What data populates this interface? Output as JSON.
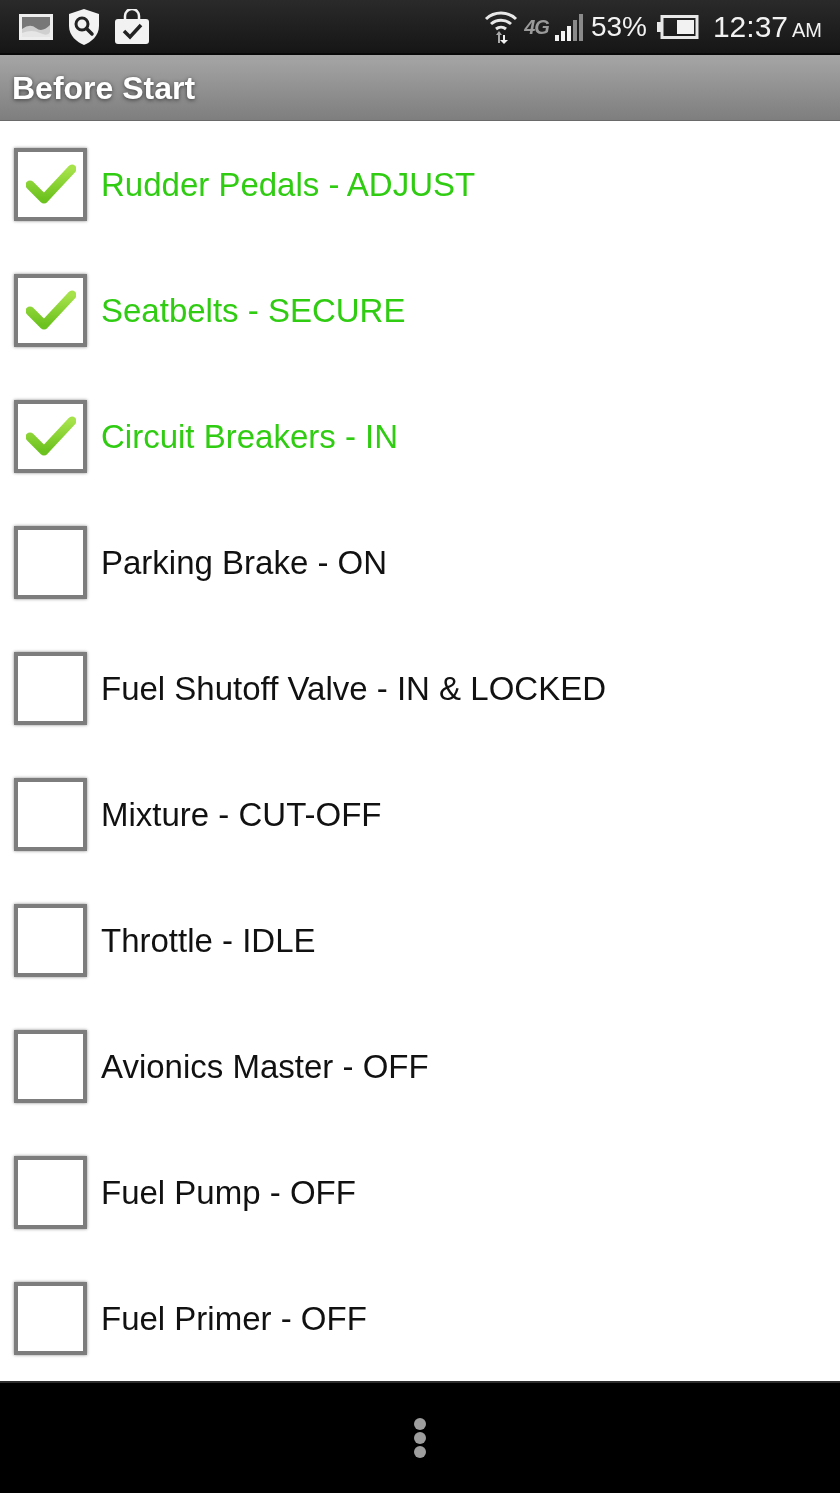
{
  "status_bar": {
    "network": "4G",
    "battery_percent": "53%",
    "time": "12:37",
    "meridiem": "AM"
  },
  "title_bar": {
    "title": "Before Start"
  },
  "checklist": [
    {
      "label": "Rudder Pedals - ADJUST",
      "checked": true
    },
    {
      "label": "Seatbelts - SECURE",
      "checked": true
    },
    {
      "label": "Circuit Breakers - IN",
      "checked": true
    },
    {
      "label": "Parking Brake - ON",
      "checked": false
    },
    {
      "label": "Fuel Shutoff Valve - IN & LOCKED",
      "checked": false
    },
    {
      "label": "Mixture - CUT-OFF",
      "checked": false
    },
    {
      "label": "Throttle - IDLE",
      "checked": false
    },
    {
      "label": "Avionics Master - OFF",
      "checked": false
    },
    {
      "label": "Fuel Pump - OFF",
      "checked": false
    },
    {
      "label": "Fuel Primer - OFF",
      "checked": false
    }
  ]
}
